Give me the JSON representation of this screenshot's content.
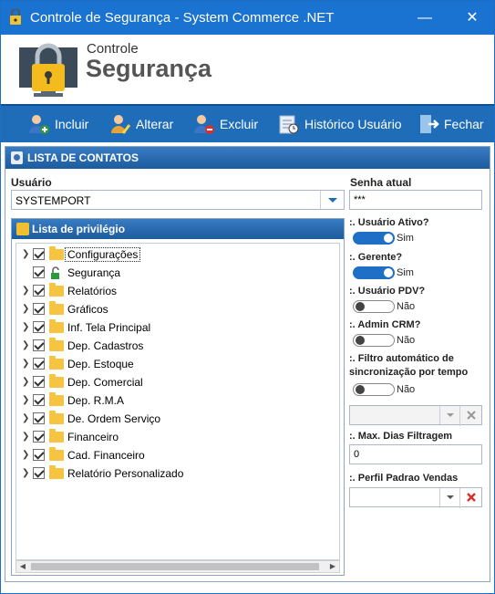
{
  "window": {
    "title": "Controle de Segurança - System Commerce .NET"
  },
  "header": {
    "brand_small": "Controle",
    "brand_big": "Segurança"
  },
  "toolbar": {
    "incluir": "Incluir",
    "alterar": "Alterar",
    "excluir": "Excluir",
    "historico": "Histórico Usuário",
    "fechar": "Fechar"
  },
  "panel": {
    "title": "LISTA DE CONTATOS"
  },
  "usuario": {
    "label": "Usuário",
    "value": "SYSTEMPORT"
  },
  "privileges": {
    "title": "Lista de privilégio",
    "items": [
      {
        "label": "Configurações",
        "checked": true,
        "expandable": true,
        "icon": "folder-icon"
      },
      {
        "label": "Segurança",
        "checked": true,
        "expandable": false,
        "icon": "lock-icon"
      },
      {
        "label": "Relatórios",
        "checked": true,
        "expandable": true,
        "icon": "folder-icon"
      },
      {
        "label": "Gráficos",
        "checked": true,
        "expandable": true,
        "icon": "folder-icon"
      },
      {
        "label": "Inf. Tela Principal",
        "checked": true,
        "expandable": true,
        "icon": "folder-icon"
      },
      {
        "label": "Dep. Cadastros",
        "checked": true,
        "expandable": true,
        "icon": "folder-icon"
      },
      {
        "label": "Dep. Estoque",
        "checked": true,
        "expandable": true,
        "icon": "folder-icon"
      },
      {
        "label": "Dep. Comercial",
        "checked": true,
        "expandable": true,
        "icon": "folder-icon"
      },
      {
        "label": "Dep. R.M.A",
        "checked": true,
        "expandable": true,
        "icon": "folder-icon"
      },
      {
        "label": "De. Ordem Serviço",
        "checked": true,
        "expandable": true,
        "icon": "folder-icon"
      },
      {
        "label": "Financeiro",
        "checked": true,
        "expandable": true,
        "icon": "folder-icon"
      },
      {
        "label": "Cad. Financeiro",
        "checked": true,
        "expandable": true,
        "icon": "folder-icon"
      },
      {
        "label": "Relatório Personalizado",
        "checked": true,
        "expandable": true,
        "icon": "folder-icon"
      }
    ]
  },
  "senha": {
    "label": "Senha atual",
    "value": "***"
  },
  "usuario_ativo": {
    "label": ":. Usuário Ativo?",
    "state": "Sim",
    "on": true
  },
  "gerente": {
    "label": ":. Gerente?",
    "state": "Sim",
    "on": true
  },
  "usuario_pdv": {
    "label": ":. Usuário PDV?",
    "state": "Não",
    "on": false
  },
  "admin_crm": {
    "label": ":. Admin CRM?",
    "state": "Não",
    "on": false
  },
  "filtro": {
    "label_line1": ":. Filtro automático de",
    "label_line2": "sincronização por tempo",
    "state": "Não",
    "on": false
  },
  "filtro_combo": {
    "value": ""
  },
  "max_dias": {
    "label": ":. Max. Dias Filtragem",
    "value": "0"
  },
  "perfil": {
    "label": ":. Perfil Padrao Vendas",
    "value": ""
  },
  "colors": {
    "titlebar": "#1a73d0",
    "toolbar": "#1f6cb8",
    "toggle_on": "#1f6fc6",
    "clear_red": "#d9302a"
  }
}
